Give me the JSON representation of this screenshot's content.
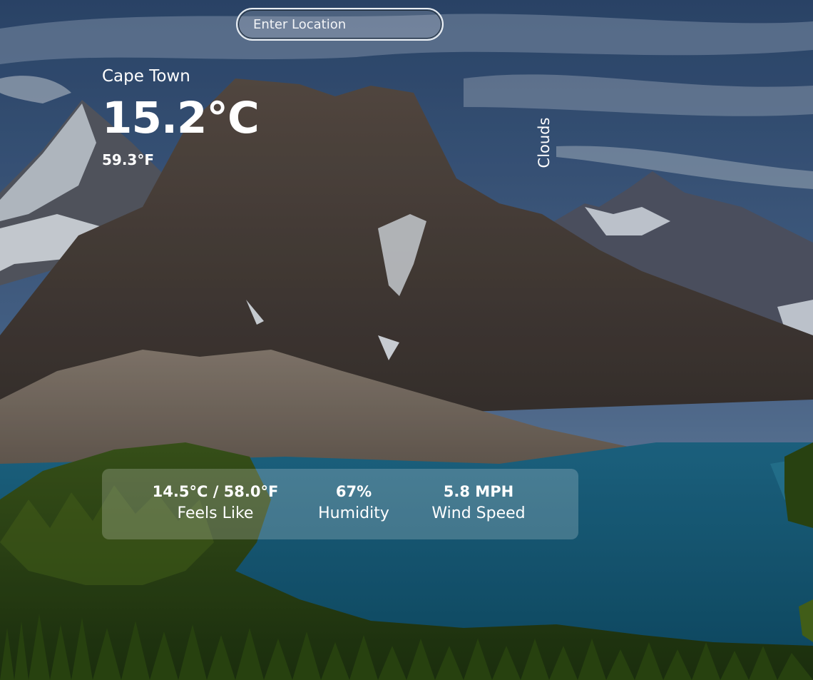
{
  "search": {
    "placeholder": "Enter Location",
    "value": ""
  },
  "weather": {
    "city": "Cape Town",
    "temp_c": "15.2°C",
    "temp_f": "59.3°F",
    "condition": "Clouds"
  },
  "stats": {
    "feels_like_value": "14.5°C / 58.0°F",
    "feels_like_label": "Feels Like",
    "humidity_value": "67%",
    "humidity_label": "Humidity",
    "wind_value": "5.8 MPH",
    "wind_label": "Wind Speed"
  }
}
